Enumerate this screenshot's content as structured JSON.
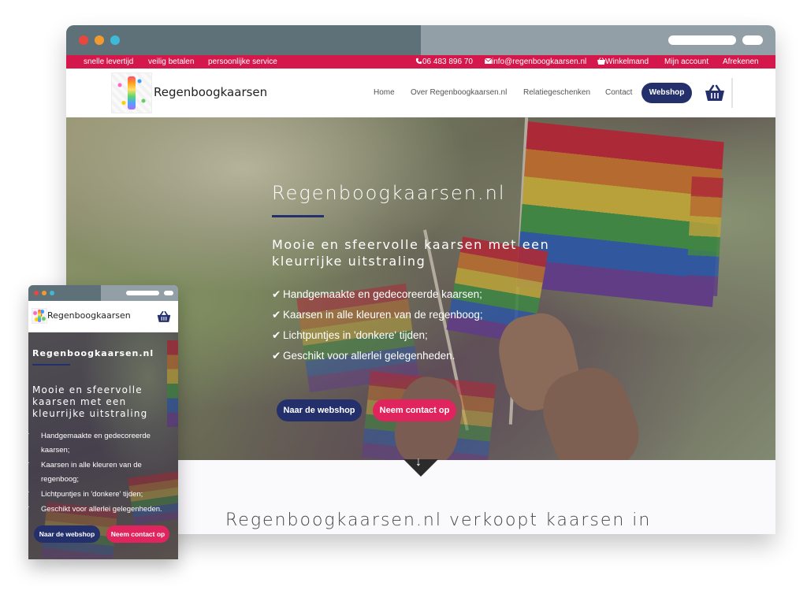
{
  "desktop": {
    "topbar": {
      "left": [
        "snelle levertijd",
        "veilig betalen",
        "persoonlijke service"
      ],
      "phone": "06 483 896 70",
      "email": "info@regenboogkaarsen.nl",
      "cart": "Winkelmand",
      "account": "Mijn account",
      "checkout": "Afrekenen"
    },
    "nav": {
      "logo_text": "Regenboogkaarsen",
      "links": [
        "Home",
        "Over Regenboogkaarsen.nl",
        "Relatiegeschenken",
        "Contact"
      ],
      "webshop": "Webshop"
    },
    "hero": {
      "title": "Regenboogkaarsen.nl",
      "subtitle": "Mooie en sfeervolle kaarsen met een kleurrijke uitstraling",
      "list": [
        "Handgemaakte en gedecoreerde kaarsen;",
        "Kaarsen in alle kleuren van de regenboog;",
        "Lichtpuntjes in 'donkere' tijden;",
        "Geschikt voor allerlei gelegenheden."
      ],
      "btn_webshop": "Naar de webshop",
      "btn_contact": "Neem contact op"
    },
    "bottom_heading": "Regenboogkaarsen.nl verkoopt kaarsen in"
  },
  "mobile": {
    "logo_text": "Regenboogkaarsen",
    "title": "Regenboogkaarsen.nl",
    "subtitle": "Mooie en sfeervolle kaarsen met een kleurrijke uitstraling",
    "list": [
      "Handgemaakte en gedecoreerde kaarsen;",
      "Kaarsen in alle kleuren van de regenboog;",
      "Lichtpuntjes in 'donkere' tijden;",
      "Geschikt voor allerlei gelegenheden."
    ],
    "btn_webshop": "Naar de webshop",
    "btn_contact": "Neem contact op"
  },
  "icons": {
    "check": "✔",
    "arrow_down": "↓",
    "phone": "phone-icon",
    "mail": "mail-icon",
    "basket": "basket-icon"
  },
  "colors": {
    "topbar": "#d4184c",
    "navy": "#23306b",
    "pink": "#e0245e",
    "chrome_dark": "#5f7178",
    "chrome_light": "#939fa6",
    "dot_red": "#e8473e",
    "dot_orange": "#f29a2e",
    "dot_cyan": "#40b9d6"
  }
}
